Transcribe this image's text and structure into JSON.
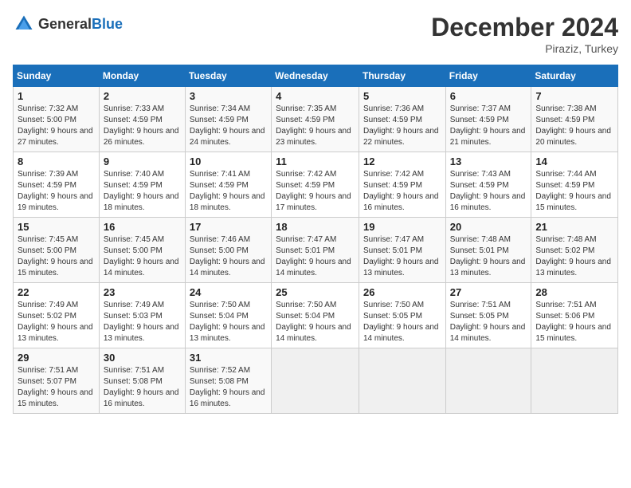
{
  "header": {
    "logo_general": "General",
    "logo_blue": "Blue",
    "month_title": "December 2024",
    "location": "Piraziz, Turkey"
  },
  "weekdays": [
    "Sunday",
    "Monday",
    "Tuesday",
    "Wednesday",
    "Thursday",
    "Friday",
    "Saturday"
  ],
  "weeks": [
    [
      {
        "day": "1",
        "info": "Sunrise: 7:32 AM\nSunset: 5:00 PM\nDaylight: 9 hours and 27 minutes."
      },
      {
        "day": "2",
        "info": "Sunrise: 7:33 AM\nSunset: 4:59 PM\nDaylight: 9 hours and 26 minutes."
      },
      {
        "day": "3",
        "info": "Sunrise: 7:34 AM\nSunset: 4:59 PM\nDaylight: 9 hours and 24 minutes."
      },
      {
        "day": "4",
        "info": "Sunrise: 7:35 AM\nSunset: 4:59 PM\nDaylight: 9 hours and 23 minutes."
      },
      {
        "day": "5",
        "info": "Sunrise: 7:36 AM\nSunset: 4:59 PM\nDaylight: 9 hours and 22 minutes."
      },
      {
        "day": "6",
        "info": "Sunrise: 7:37 AM\nSunset: 4:59 PM\nDaylight: 9 hours and 21 minutes."
      },
      {
        "day": "7",
        "info": "Sunrise: 7:38 AM\nSunset: 4:59 PM\nDaylight: 9 hours and 20 minutes."
      }
    ],
    [
      {
        "day": "8",
        "info": "Sunrise: 7:39 AM\nSunset: 4:59 PM\nDaylight: 9 hours and 19 minutes."
      },
      {
        "day": "9",
        "info": "Sunrise: 7:40 AM\nSunset: 4:59 PM\nDaylight: 9 hours and 18 minutes."
      },
      {
        "day": "10",
        "info": "Sunrise: 7:41 AM\nSunset: 4:59 PM\nDaylight: 9 hours and 18 minutes."
      },
      {
        "day": "11",
        "info": "Sunrise: 7:42 AM\nSunset: 4:59 PM\nDaylight: 9 hours and 17 minutes."
      },
      {
        "day": "12",
        "info": "Sunrise: 7:42 AM\nSunset: 4:59 PM\nDaylight: 9 hours and 16 minutes."
      },
      {
        "day": "13",
        "info": "Sunrise: 7:43 AM\nSunset: 4:59 PM\nDaylight: 9 hours and 16 minutes."
      },
      {
        "day": "14",
        "info": "Sunrise: 7:44 AM\nSunset: 4:59 PM\nDaylight: 9 hours and 15 minutes."
      }
    ],
    [
      {
        "day": "15",
        "info": "Sunrise: 7:45 AM\nSunset: 5:00 PM\nDaylight: 9 hours and 15 minutes."
      },
      {
        "day": "16",
        "info": "Sunrise: 7:45 AM\nSunset: 5:00 PM\nDaylight: 9 hours and 14 minutes."
      },
      {
        "day": "17",
        "info": "Sunrise: 7:46 AM\nSunset: 5:00 PM\nDaylight: 9 hours and 14 minutes."
      },
      {
        "day": "18",
        "info": "Sunrise: 7:47 AM\nSunset: 5:01 PM\nDaylight: 9 hours and 14 minutes."
      },
      {
        "day": "19",
        "info": "Sunrise: 7:47 AM\nSunset: 5:01 PM\nDaylight: 9 hours and 13 minutes."
      },
      {
        "day": "20",
        "info": "Sunrise: 7:48 AM\nSunset: 5:01 PM\nDaylight: 9 hours and 13 minutes."
      },
      {
        "day": "21",
        "info": "Sunrise: 7:48 AM\nSunset: 5:02 PM\nDaylight: 9 hours and 13 minutes."
      }
    ],
    [
      {
        "day": "22",
        "info": "Sunrise: 7:49 AM\nSunset: 5:02 PM\nDaylight: 9 hours and 13 minutes."
      },
      {
        "day": "23",
        "info": "Sunrise: 7:49 AM\nSunset: 5:03 PM\nDaylight: 9 hours and 13 minutes."
      },
      {
        "day": "24",
        "info": "Sunrise: 7:50 AM\nSunset: 5:04 PM\nDaylight: 9 hours and 13 minutes."
      },
      {
        "day": "25",
        "info": "Sunrise: 7:50 AM\nSunset: 5:04 PM\nDaylight: 9 hours and 14 minutes."
      },
      {
        "day": "26",
        "info": "Sunrise: 7:50 AM\nSunset: 5:05 PM\nDaylight: 9 hours and 14 minutes."
      },
      {
        "day": "27",
        "info": "Sunrise: 7:51 AM\nSunset: 5:05 PM\nDaylight: 9 hours and 14 minutes."
      },
      {
        "day": "28",
        "info": "Sunrise: 7:51 AM\nSunset: 5:06 PM\nDaylight: 9 hours and 15 minutes."
      }
    ],
    [
      {
        "day": "29",
        "info": "Sunrise: 7:51 AM\nSunset: 5:07 PM\nDaylight: 9 hours and 15 minutes."
      },
      {
        "day": "30",
        "info": "Sunrise: 7:51 AM\nSunset: 5:08 PM\nDaylight: 9 hours and 16 minutes."
      },
      {
        "day": "31",
        "info": "Sunrise: 7:52 AM\nSunset: 5:08 PM\nDaylight: 9 hours and 16 minutes."
      },
      null,
      null,
      null,
      null
    ]
  ]
}
